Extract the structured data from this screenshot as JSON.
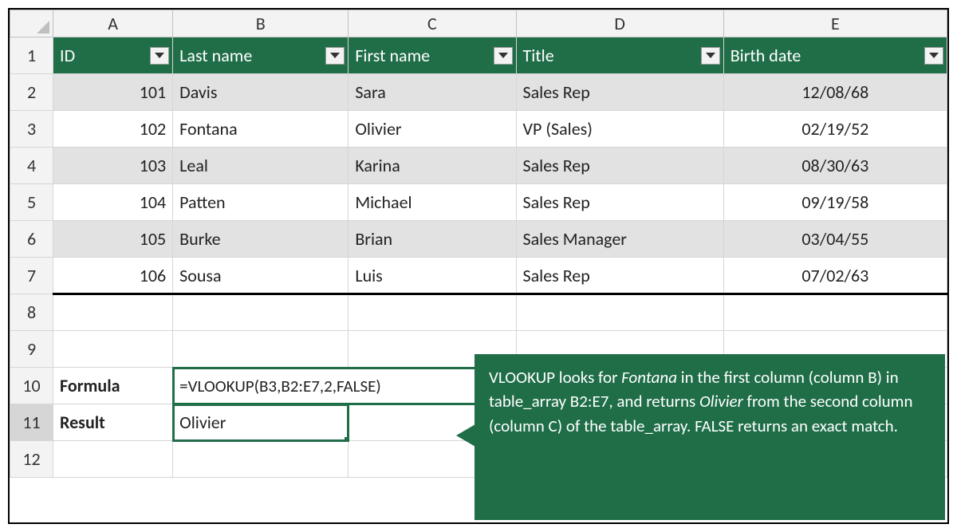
{
  "columns": {
    "A": "A",
    "B": "B",
    "C": "C",
    "D": "D",
    "E": "E"
  },
  "row_labels": [
    "1",
    "2",
    "3",
    "4",
    "5",
    "6",
    "7",
    "8",
    "9",
    "10",
    "11",
    "12"
  ],
  "headers": [
    "ID",
    "Last name",
    "First name",
    "Title",
    "Birth date"
  ],
  "rows": [
    {
      "id": "101",
      "last": "Davis",
      "first": "Sara",
      "title": "Sales Rep",
      "birth": "12/08/68"
    },
    {
      "id": "102",
      "last": "Fontana",
      "first": "Olivier",
      "title": "VP (Sales)",
      "birth": "02/19/52"
    },
    {
      "id": "103",
      "last": "Leal",
      "first": "Karina",
      "title": "Sales Rep",
      "birth": "08/30/63"
    },
    {
      "id": "104",
      "last": "Patten",
      "first": "Michael",
      "title": "Sales Rep",
      "birth": "09/19/58"
    },
    {
      "id": "105",
      "last": "Burke",
      "first": "Brian",
      "title": "Sales Manager",
      "birth": "03/04/55"
    },
    {
      "id": "106",
      "last": "Sousa",
      "first": "Luis",
      "title": "Sales Rep",
      "birth": "07/02/63"
    }
  ],
  "labels": {
    "formula_label": "Formula",
    "result_label": "Result"
  },
  "formula": "=VLOOKUP(B3,B2:E7,2,FALSE)",
  "result": "Olivier",
  "callout": {
    "t1": "VLOOKUP looks for ",
    "i1": "Fontana",
    "t2": " in the first column (column B) in table_array B2:E7, and returns ",
    "i2": "Olivier",
    "t3": " from the second column (column C) of the table_array. FALSE returns an exact match."
  }
}
